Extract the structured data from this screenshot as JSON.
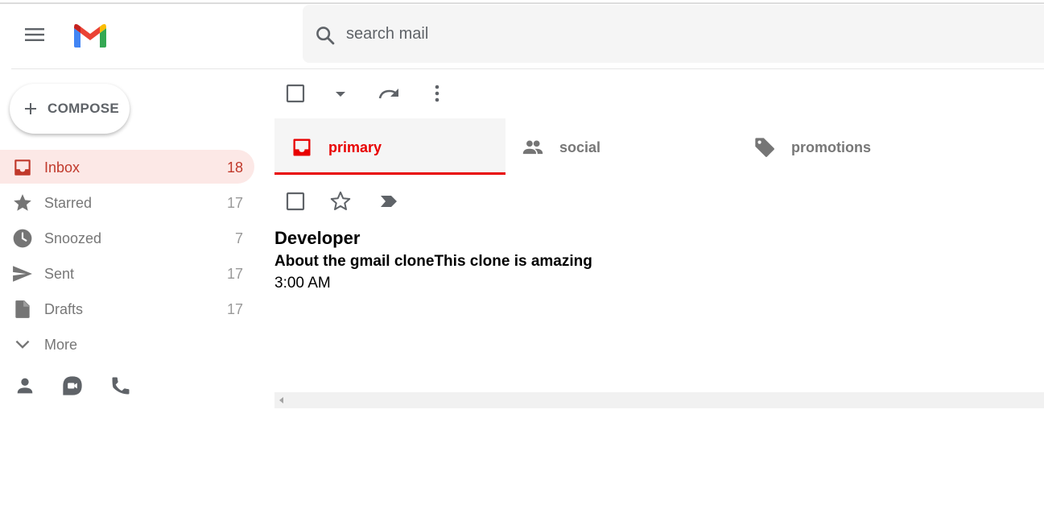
{
  "header": {
    "menu_icon": "hamburger-menu-icon",
    "logo": "gmail-logo",
    "search": {
      "placeholder": "search mail",
      "value": "",
      "icon": "search-icon"
    }
  },
  "sidebar": {
    "compose_label": "COMPOSE",
    "items": [
      {
        "label": "Inbox",
        "count": "18",
        "icon": "inbox-icon",
        "active": true
      },
      {
        "label": "Starred",
        "count": "17",
        "icon": "star-icon",
        "active": false
      },
      {
        "label": "Snoozed",
        "count": "7",
        "icon": "clock-icon",
        "active": false
      },
      {
        "label": "Sent",
        "count": "17",
        "icon": "send-icon",
        "active": false
      },
      {
        "label": "Drafts",
        "count": "17",
        "icon": "draft-icon",
        "active": false
      },
      {
        "label": "More",
        "count": "",
        "icon": "chevron-down-icon",
        "active": false
      }
    ],
    "bottom_icons": [
      "person-icon",
      "duo-icon",
      "phone-icon"
    ]
  },
  "toolbar": {
    "icons": [
      "checkbox-icon",
      "arrow-drop-down-icon",
      "redo-icon",
      "more-vert-icon"
    ]
  },
  "tabs": [
    {
      "label": "primary",
      "icon": "inbox-icon",
      "active": true
    },
    {
      "label": "social",
      "icon": "people-icon",
      "active": false
    },
    {
      "label": "promotions",
      "icon": "tag-icon",
      "active": false
    }
  ],
  "emails": [
    {
      "sender": "Developer",
      "subject": "About the gmail cloneThis clone is amazing",
      "time": "3:00 AM"
    }
  ],
  "colors": {
    "accent_red": "#e80000",
    "active_item_bg": "#fce8e6",
    "active_item_text": "#c0392b",
    "icon_gray": "#777777",
    "search_bg": "#f5f5f5"
  }
}
